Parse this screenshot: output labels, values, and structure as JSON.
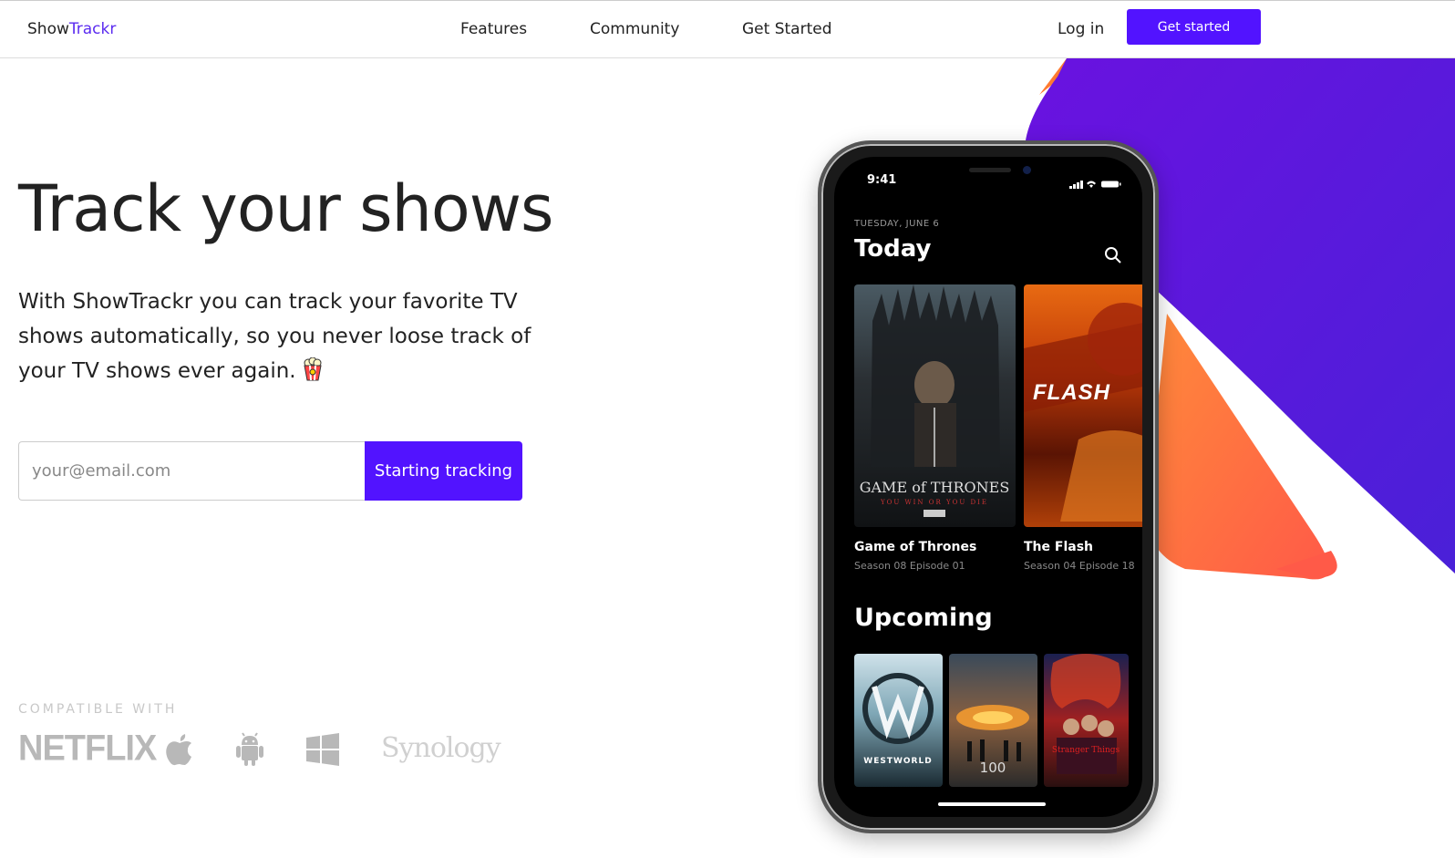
{
  "nav": {
    "brand_prefix": "Show",
    "brand_accent": "Trackr",
    "links": [
      "Features",
      "Community",
      "Get Started"
    ],
    "login": "Log in",
    "cta": "Get started"
  },
  "hero": {
    "headline": "Track your shows",
    "subhead": "With ShowTrackr you can track your favorite TV shows automatically, so you never loose track of your TV shows ever again.",
    "email_placeholder": "your@email.com",
    "submit": "Starting tracking"
  },
  "compat": {
    "label": "COMPATIBLE WITH",
    "logos": [
      "NETFLIX",
      "apple-icon",
      "android-icon",
      "windows-icon",
      "Synology"
    ]
  },
  "phone": {
    "time": "9:41",
    "date": "TUESDAY, JUNE 6",
    "section_today": "Today",
    "today": [
      {
        "title": "Game of Thrones",
        "subtitle": "Season 08 Episode 01"
      },
      {
        "title": "The Flash",
        "subtitle": "Season 04 Episode 18"
      }
    ],
    "section_upcoming": "Upcoming",
    "upcoming": [
      "WESTWORLD",
      "100",
      "Stranger Things"
    ]
  },
  "colors": {
    "accent": "#5213ff",
    "text": "#222222",
    "muted_logo": "#b8b8b8"
  }
}
